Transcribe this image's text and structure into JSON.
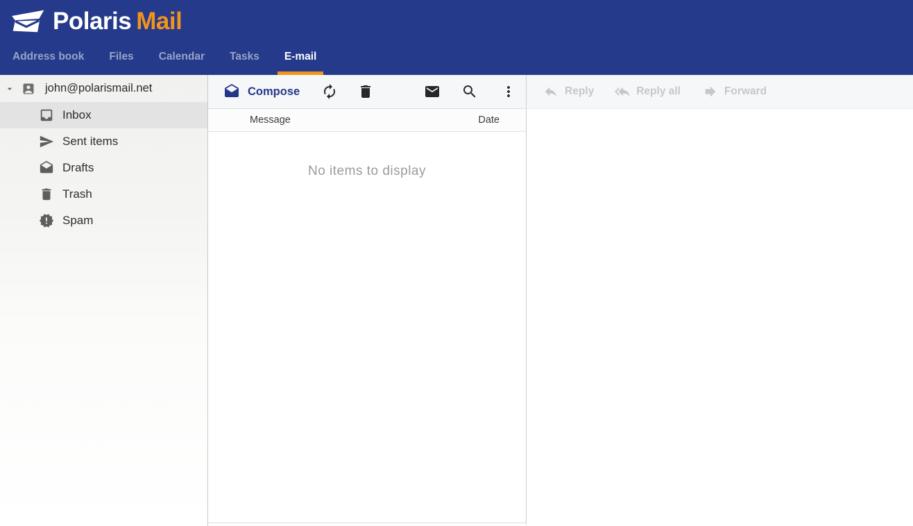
{
  "header": {
    "logo": {
      "icon": "polaris-envelope-logo",
      "text_primary": "Polaris",
      "text_secondary": "Mail"
    },
    "nav_tabs": [
      {
        "label": "Address book",
        "active": false
      },
      {
        "label": "Files",
        "active": false
      },
      {
        "label": "Calendar",
        "active": false
      },
      {
        "label": "Tasks",
        "active": false
      },
      {
        "label": "E-mail",
        "active": true
      }
    ]
  },
  "sidebar": {
    "account": {
      "email": "john@polarismail.net",
      "icon": "person-icon",
      "expanded": true
    },
    "folders": [
      {
        "label": "Inbox",
        "icon": "inbox-icon",
        "selected": true
      },
      {
        "label": "Sent items",
        "icon": "send-icon",
        "selected": false
      },
      {
        "label": "Drafts",
        "icon": "drafts-icon",
        "selected": false
      },
      {
        "label": "Trash",
        "icon": "trash-icon",
        "selected": false
      },
      {
        "label": "Spam",
        "icon": "spam-icon",
        "selected": false
      }
    ]
  },
  "message_list": {
    "toolbar": {
      "compose_label": "Compose",
      "icons": [
        "refresh-icon",
        "delete-icon",
        "mail-icon",
        "search-icon",
        "more-vert-icon"
      ]
    },
    "columns": {
      "message": "Message",
      "date": "Date"
    },
    "empty_text": "No items to display"
  },
  "reading_pane": {
    "toolbar": [
      {
        "label": "Reply",
        "icon": "reply-icon",
        "enabled": false
      },
      {
        "label": "Reply all",
        "icon": "reply-all-icon",
        "enabled": false
      },
      {
        "label": "Forward",
        "icon": "forward-icon",
        "enabled": false
      }
    ]
  },
  "colors": {
    "header_bg": "#253a8a",
    "accent_orange": "#f0931f",
    "compose_blue": "#24388a",
    "inactive_tab": "#98a4c8",
    "disabled_gray": "#c7c7c7",
    "selected_row_bg": "#e3e3e3"
  }
}
